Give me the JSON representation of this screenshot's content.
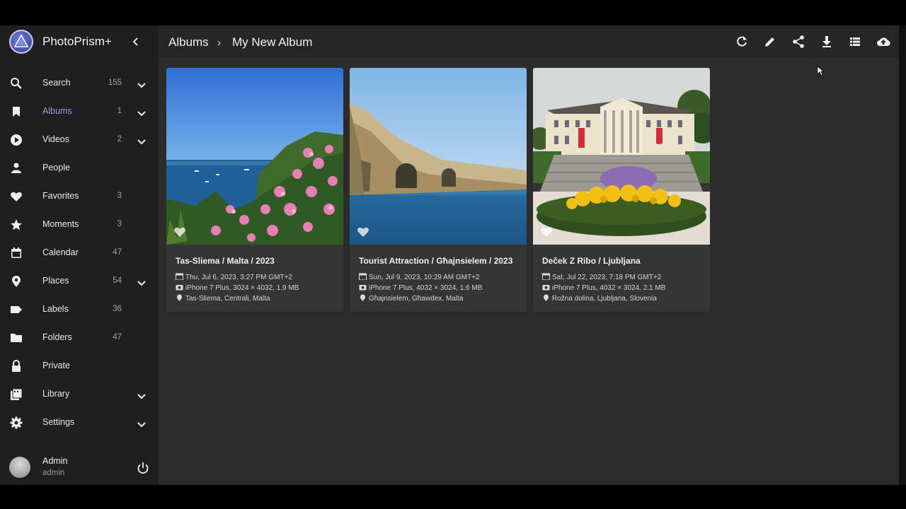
{
  "app": {
    "name": "PhotoPrism+"
  },
  "sidebar": {
    "items": [
      {
        "label": "Search",
        "count": "155",
        "icon": "search-icon",
        "chevron": true
      },
      {
        "label": "Albums",
        "count": "1",
        "icon": "bookmark-icon",
        "chevron": true,
        "active": true
      },
      {
        "label": "Videos",
        "count": "2",
        "icon": "play-circle-icon",
        "chevron": true
      },
      {
        "label": "People",
        "count": "",
        "icon": "person-icon",
        "chevron": false
      },
      {
        "label": "Favorites",
        "count": "3",
        "icon": "heart-icon",
        "chevron": false
      },
      {
        "label": "Moments",
        "count": "3",
        "icon": "star-icon",
        "chevron": false
      },
      {
        "label": "Calendar",
        "count": "47",
        "icon": "calendar-icon",
        "chevron": false
      },
      {
        "label": "Places",
        "count": "54",
        "icon": "map-pin-icon",
        "chevron": true
      },
      {
        "label": "Labels",
        "count": "36",
        "icon": "label-icon",
        "chevron": false
      },
      {
        "label": "Folders",
        "count": "47",
        "icon": "folder-icon",
        "chevron": false
      },
      {
        "label": "Private",
        "count": "",
        "icon": "lock-icon",
        "chevron": false
      },
      {
        "label": "Library",
        "count": "",
        "icon": "library-icon",
        "chevron": true
      },
      {
        "label": "Settings",
        "count": "",
        "icon": "gear-icon",
        "chevron": true
      }
    ]
  },
  "user": {
    "name": "Admin",
    "login": "admin"
  },
  "toolbar": {
    "breadcrumb_root": "Albums",
    "breadcrumb_sep": "›",
    "breadcrumb_current": "My New Album",
    "actions": [
      "refresh-icon",
      "edit-icon",
      "share-icon",
      "download-icon",
      "list-view-icon",
      "upload-cloud-icon"
    ]
  },
  "photos": [
    {
      "title": "Tas-Sliema / Malta / 2023",
      "date": "Thu, Jul 6, 2023, 3:27 PM GMT+2",
      "camera": "iPhone 7 Plus, 3024 × 4032, 1.9 MB",
      "place": "Tas-Sliema, Centrali, Malta"
    },
    {
      "title": "Tourist Attraction / Għajnsielem / 2023",
      "date": "Sun, Jul 9, 2023, 10:29 AM GMT+2",
      "camera": "iPhone 7 Plus, 4032 × 3024, 1.6 MB",
      "place": "Għajnsielem, Għawdex, Malta"
    },
    {
      "title": "Deček Z Ribo / Ljubljana",
      "date": "Sat, Jul 22, 2023, 7:18 PM GMT+2",
      "camera": "iPhone 7 Plus, 4032 × 3024, 2.1 MB",
      "place": "Rožna dolina, Ljubljana, Slovenia"
    }
  ],
  "colors": {
    "accent": "#a98ee6",
    "sidebar_bg": "#1f1f1f",
    "content_bg": "#2b2b2b",
    "card_bg": "#353535"
  }
}
